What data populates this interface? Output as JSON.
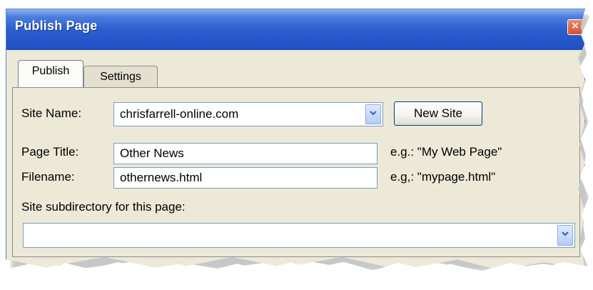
{
  "window": {
    "title": "Publish Page",
    "close_label": "×"
  },
  "tabs": [
    {
      "label": "Publish",
      "active": true
    },
    {
      "label": "Settings",
      "active": false
    }
  ],
  "form": {
    "site_name_label": "Site Name:",
    "site_name_value": "chrisfarrell-online.com",
    "new_site_label": "New Site",
    "page_title_label": "Page Title:",
    "page_title_value": "Other News",
    "page_title_hint": "e.g.: \"My Web Page\"",
    "filename_label": "Filename:",
    "filename_value": "othernews.html",
    "filename_hint": "e.g,: \"mypage.html\"",
    "subdirectory_label": "Site subdirectory for this page:",
    "subdirectory_value": ""
  },
  "icons": {
    "close": "close-icon",
    "dropdown": "chevron-down-icon"
  },
  "colors": {
    "titlebar": "#2d5fd0",
    "window_bg": "#ece9d8",
    "input_border": "#7f9db9",
    "button_border": "#003c74"
  }
}
